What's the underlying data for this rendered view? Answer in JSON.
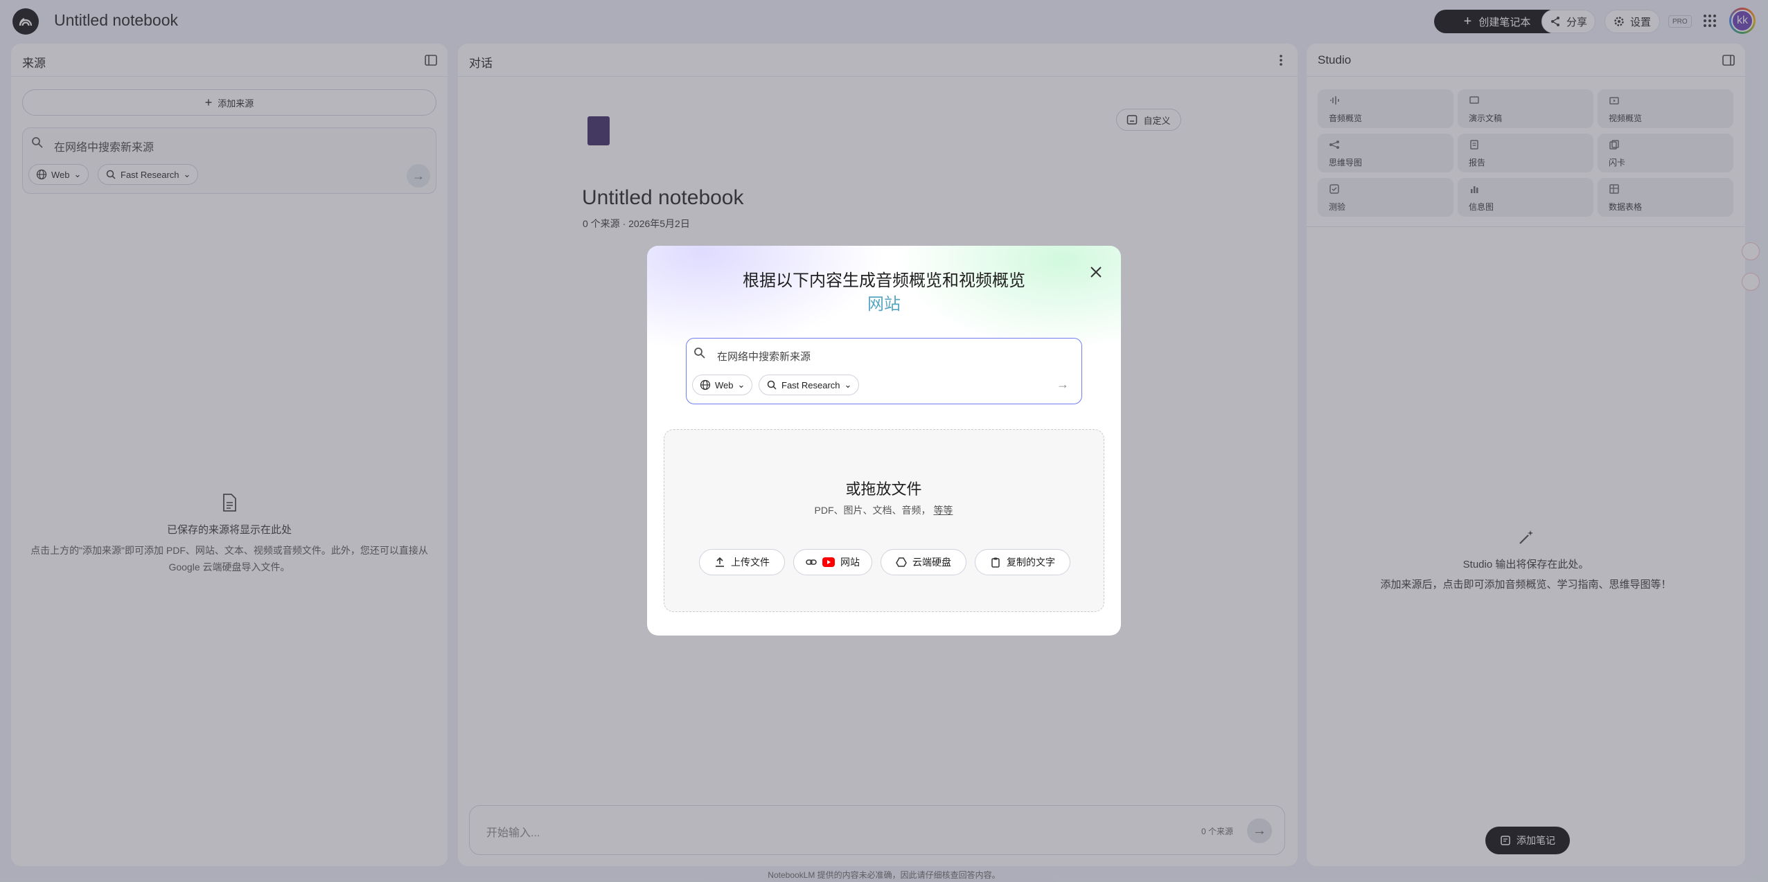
{
  "header": {
    "notebook_title": "Untitled notebook",
    "create_label": "创建笔记本",
    "share_label": "分享",
    "settings_label": "设置",
    "pro_badge": "PRO",
    "avatar_initials": "kk"
  },
  "sources": {
    "title": "来源",
    "add_label": "添加来源",
    "search_placeholder": "在网络中搜索新来源",
    "web_chip": "Web",
    "research_chip": "Fast Research",
    "empty_title": "已保存的来源将显示在此处",
    "empty_desc": "点击上方的\"添加来源\"即可添加 PDF、网站、文本、视频或音频文件。此外，您还可以直接从 Google 云端硬盘导入文件。"
  },
  "chat": {
    "title": "对话",
    "customize_label": "自定义",
    "notebook_title": "Untitled notebook",
    "meta": "0 个来源 · 2026年5月2日",
    "input_placeholder": "开始输入...",
    "source_count": "0 个来源"
  },
  "studio": {
    "title": "Studio",
    "tiles": [
      {
        "label": "音频概览",
        "icon": "waveform-icon"
      },
      {
        "label": "演示文稿",
        "icon": "slides-icon"
      },
      {
        "label": "视频概览",
        "icon": "video-icon"
      },
      {
        "label": "思维导图",
        "icon": "mindmap-icon"
      },
      {
        "label": "报告",
        "icon": "report-icon"
      },
      {
        "label": "闪卡",
        "icon": "flashcard-icon"
      },
      {
        "label": "测验",
        "icon": "quiz-icon"
      },
      {
        "label": "信息图",
        "icon": "infographic-icon"
      },
      {
        "label": "数据表格",
        "icon": "table-icon"
      }
    ],
    "empty_title": "Studio 输出将保存在此处。",
    "empty_desc": "添加来源后，点击即可添加音频概览、学习指南、思维导图等！",
    "add_note_label": "添加笔记"
  },
  "footer": {
    "disclaimer": "NotebookLM 提供的内容未必准确，因此请仔细核查回答内容。"
  },
  "modal": {
    "title": "根据以下内容生成音频概览和视频概览",
    "subtitle": "网站",
    "search_placeholder": "在网络中搜索新来源",
    "web_chip": "Web",
    "research_chip": "Fast Research",
    "drop_title": "或拖放文件",
    "drop_types": "PDF、图片、文档、音频，",
    "drop_more": "等等",
    "upload_label": "上传文件",
    "website_label": "网站",
    "drive_label": "云端硬盘",
    "paste_label": "复制的文字"
  },
  "colors": {
    "accent_border": "#6e7ef0",
    "primary_button": "#0b0b0b",
    "subtitle_gradient_start": "#5b87e8",
    "subtitle_gradient_end": "#4fc39c"
  }
}
